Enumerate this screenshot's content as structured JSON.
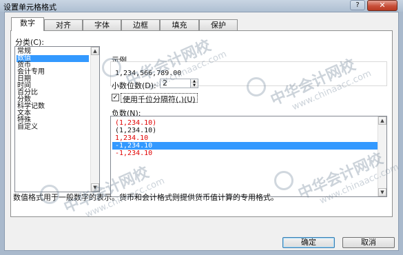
{
  "window": {
    "title": "设置单元格格式",
    "help_label": "?",
    "close_label": "✕"
  },
  "tabs": [
    {
      "label": "数字",
      "active": true
    },
    {
      "label": "对齐",
      "active": false
    },
    {
      "label": "字体",
      "active": false
    },
    {
      "label": "边框",
      "active": false
    },
    {
      "label": "填充",
      "active": false
    },
    {
      "label": "保护",
      "active": false
    }
  ],
  "category": {
    "label": "分类(C):",
    "items": [
      "常规",
      "数值",
      "货币",
      "会计专用",
      "日期",
      "时间",
      "百分比",
      "分数",
      "科学记数",
      "文本",
      "特殊",
      "自定义"
    ],
    "selected_index": 1
  },
  "sample": {
    "label": "示例",
    "value": "1,234,566,789.00"
  },
  "decimal": {
    "label": "小数位数(D):",
    "value": "2"
  },
  "thousands": {
    "label": "使用千位分隔符(,)(U)",
    "checked": true
  },
  "negative": {
    "label": "负数(N):",
    "items": [
      {
        "text": "(1,234.10)",
        "color": "red"
      },
      {
        "text": "(1,234.10)",
        "color": "black"
      },
      {
        "text": "1,234.10",
        "color": "red"
      },
      {
        "text": "-1,234.10",
        "color": "black",
        "selected": true
      },
      {
        "text": "-1,234.10",
        "color": "red"
      }
    ]
  },
  "description": "数值格式用于一般数字的表示。货币和会计格式则提供货币值计算的专用格式。",
  "buttons": {
    "ok": "确定",
    "cancel": "取消"
  },
  "watermark": {
    "text": "中华会计网校",
    "url": "www.chinaacc.com"
  },
  "colors": {
    "selection": "#3399ff",
    "negative_red": "#e00000",
    "frame": "#a9b9cc"
  }
}
